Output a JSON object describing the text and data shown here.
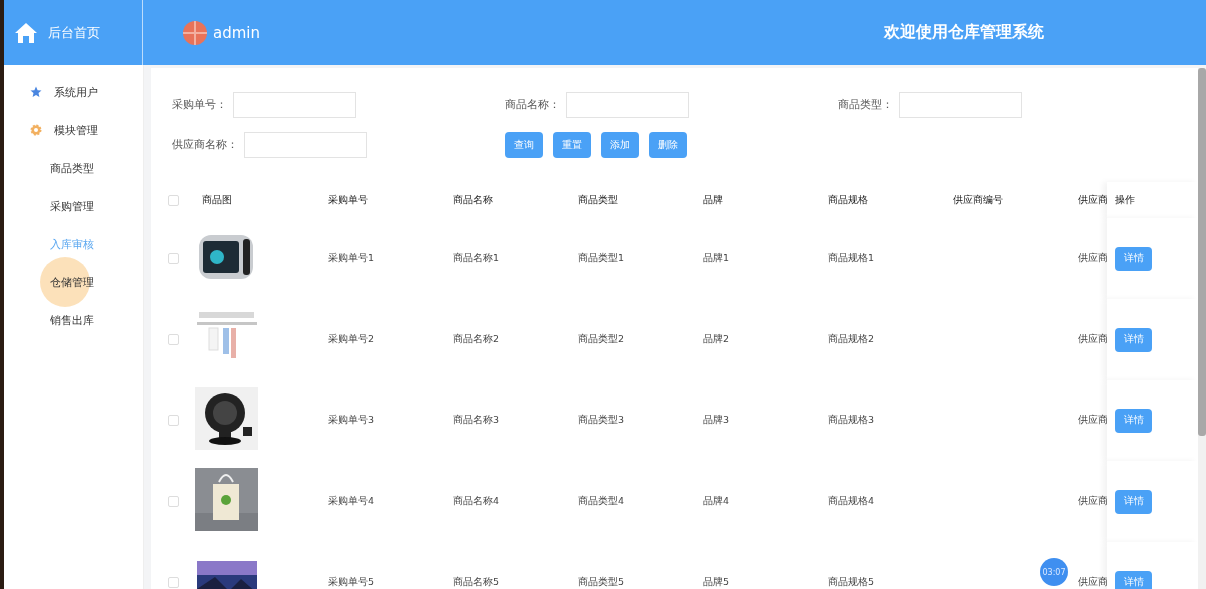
{
  "header": {
    "home_label": "后台首页",
    "user": "admin",
    "title": "欢迎使用仓库管理系统"
  },
  "sidebar": {
    "items": [
      {
        "label": "系统用户",
        "kind": "group",
        "selected": false,
        "pressed": false
      },
      {
        "label": "模块管理",
        "kind": "group",
        "selected": false,
        "pressed": false
      },
      {
        "label": "商品类型",
        "kind": "sub",
        "selected": false,
        "pressed": false
      },
      {
        "label": "采购管理",
        "kind": "sub",
        "selected": false,
        "pressed": false
      },
      {
        "label": "入库审核",
        "kind": "sub",
        "selected": true,
        "pressed": false
      },
      {
        "label": "仓储管理",
        "kind": "sub",
        "selected": false,
        "pressed": true
      },
      {
        "label": "销售出库",
        "kind": "sub",
        "selected": false,
        "pressed": false
      }
    ]
  },
  "filters": [
    {
      "label": "采购单号："
    },
    {
      "label": "商品名称："
    },
    {
      "label": "商品类型："
    },
    {
      "label": "供应商名称："
    }
  ],
  "buttons": [
    "查询",
    "重置",
    "添加",
    "删除"
  ],
  "table": {
    "select_all_checked": false,
    "columns": [
      "商品图",
      "采购单号",
      "商品名称",
      "商品类型",
      "品牌",
      "商品规格",
      "供应商编号",
      "供应商",
      "操作"
    ],
    "rows": [
      {
        "checked": false,
        "cells": [
          "",
          "采购单号1",
          "商品名称1",
          "商品类型1",
          "品牌1",
          "商品规格1",
          "",
          "供应商"
        ],
        "action": "详情"
      },
      {
        "checked": false,
        "cells": [
          "",
          "采购单号2",
          "商品名称2",
          "商品类型2",
          "品牌2",
          "商品规格2",
          "",
          "供应商"
        ],
        "action": "详情"
      },
      {
        "checked": false,
        "cells": [
          "",
          "采购单号3",
          "商品名称3",
          "商品类型3",
          "品牌3",
          "商品规格3",
          "",
          "供应商"
        ],
        "action": "详情"
      },
      {
        "checked": false,
        "cells": [
          "",
          "采购单号4",
          "商品名称4",
          "商品类型4",
          "品牌4",
          "商品规格4",
          "",
          "供应商"
        ],
        "action": "详情"
      },
      {
        "checked": false,
        "cells": [
          "",
          "采购单号5",
          "商品名称5",
          "商品类型5",
          "品牌5",
          "商品规格5",
          "",
          "供应商"
        ],
        "action": "详情"
      }
    ]
  },
  "recording_timer": "03:07"
}
